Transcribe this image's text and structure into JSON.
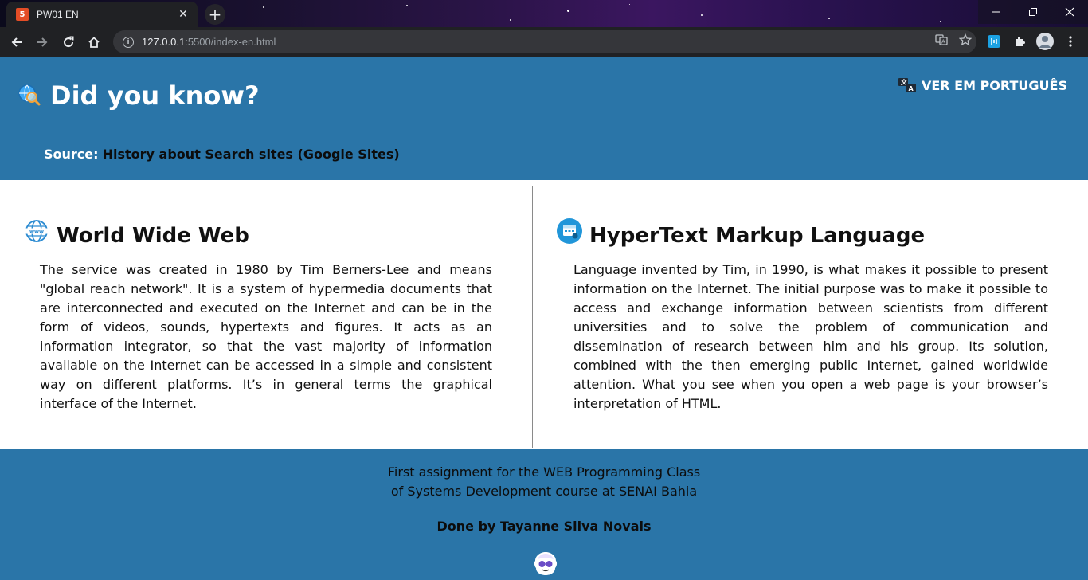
{
  "browser": {
    "tab_title": "PW01 EN",
    "tab_favicon": "html5-icon",
    "url_host": "127.0.0.1",
    "url_rest": ":5500/index-en.html"
  },
  "header": {
    "title": "Did you know?",
    "title_icon": "globe-search-icon",
    "lang_link": "VER EM PORTUGUÊS",
    "lang_icon": "translate-icon",
    "source_label": "Source:",
    "source_link": "History about Search sites (Google Sites)"
  },
  "sections": [
    {
      "title": "World Wide Web",
      "icon": "www-globe-icon",
      "text": "The service was created in 1980 by Tim Berners-Lee and means \"global reach network\". It is a system of hypermedia documents that are interconnected and executed on the Internet and can be in the form of videos, sounds, hypertexts and figures. It acts as an information integrator, so that the vast majority of information available on the Internet can be accessed in a simple and consistent way on different platforms. It’s in general terms the graphical interface of the Internet."
    },
    {
      "title": "HyperText Markup Language",
      "icon": "browser-window-icon",
      "text": "Language invented by Tim, in 1990, is what makes it possible to present information on the Internet. The initial purpose was to make it possible to access and exchange information between scientists from different universities and to solve the problem of communication and dissemination of research between him and his group. Its solution, combined with the then emerging public Internet, gained worldwide attention. What you see when you open a web page is your browser’s interpretation of HTML."
    }
  ],
  "footer": {
    "line1": "First assignment for the WEB Programming Class",
    "line2": "of Systems Development course at SENAI Bahia",
    "author": "Done by Tayanne Silva Novais",
    "logo": "avatar-logo-icon"
  },
  "colors": {
    "brand_blue": "#2a75a8",
    "chrome_dark": "#202124"
  }
}
